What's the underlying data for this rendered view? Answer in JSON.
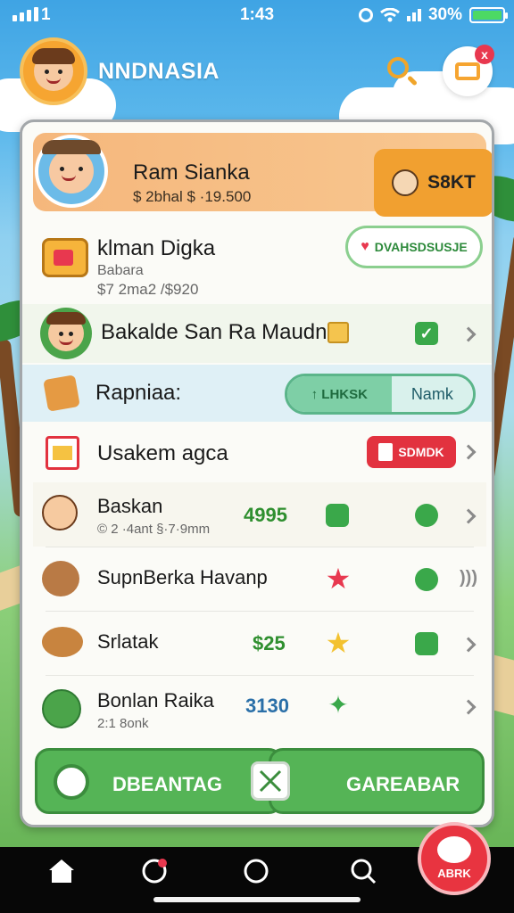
{
  "status_bar": {
    "left_number": "1",
    "time": "1:43",
    "battery_percent": "30%"
  },
  "header": {
    "app_title": "NNDNASIA",
    "notification_badge": "x"
  },
  "profile": {
    "name": "Ram Sianka",
    "subtitle": "$ 2bhal $ ·19.500",
    "button_label": "S8KT"
  },
  "rows": [
    {
      "title": "klman Digka",
      "sub1": "Babara",
      "sub2": "$7 2ma2 /$920",
      "pill_label": "DVAHSDSUSJE"
    },
    {
      "title": "Bakalde San Ra Maudn"
    },
    {
      "title": "Rapniaa:",
      "seg_left": "↑ LHKSK",
      "seg_right": "Namk"
    },
    {
      "title": "Usakem agca",
      "badge_label": "SDMDK"
    }
  ],
  "list": [
    {
      "title": "Baskan",
      "sub": "© 2 ·4ant §·7·9mm",
      "value": "4995"
    },
    {
      "title": "SupnBerka Havanp",
      "sub": "",
      "value": ""
    },
    {
      "title": "Srlatak",
      "sub": "",
      "value": "$25"
    },
    {
      "title": "Bonlan Raika",
      "sub": "2:1 8onk",
      "value": "3130"
    }
  ],
  "actions": {
    "left_label": "DBEANTAG",
    "right_label": "GAREABAR",
    "fab_label": "ABRK"
  },
  "colors": {
    "accent_orange": "#f1a030",
    "accent_green": "#55b456",
    "badge_red": "#e2323f"
  }
}
